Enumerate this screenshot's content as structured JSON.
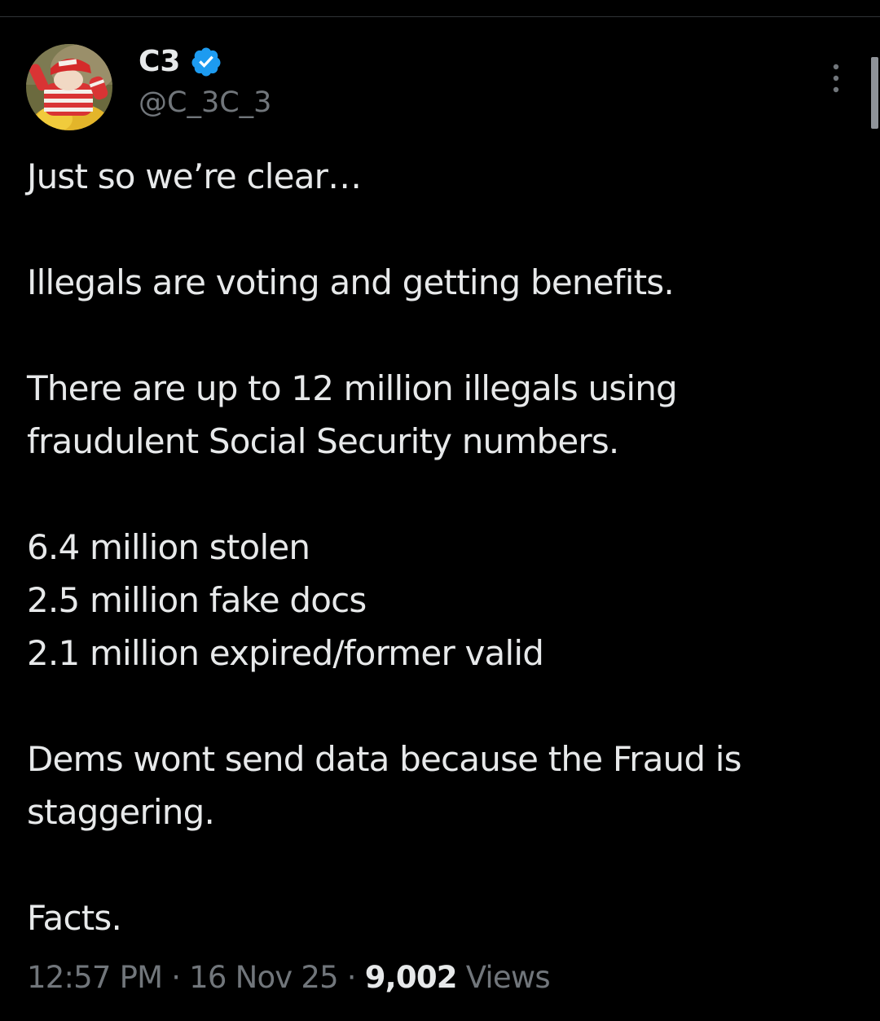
{
  "author": {
    "display_name": "C3",
    "handle": "@C_3C_3",
    "verified_icon": "verified-badge-icon",
    "badge_color": "#1d9bf0"
  },
  "tweet": {
    "paragraphs": [
      "Just so we’re clear…",
      "Illegals are voting and getting benefits.",
      "There are up to 12 million illegals using fraudulent Social Security numbers.",
      "6.4 million stolen\n2.5 million fake docs\n2.1 million expired/former valid",
      "Dems wont send data because the Fraud is staggering.",
      "Facts."
    ]
  },
  "meta": {
    "time": "12:57 PM",
    "separator": " · ",
    "date": "16 Nov 25",
    "views_count": "9,002",
    "views_label": " Views"
  },
  "colors": {
    "background": "#000000",
    "primary_text": "#e7e9ea",
    "secondary_text": "#71767b",
    "divider": "#2f3336"
  }
}
